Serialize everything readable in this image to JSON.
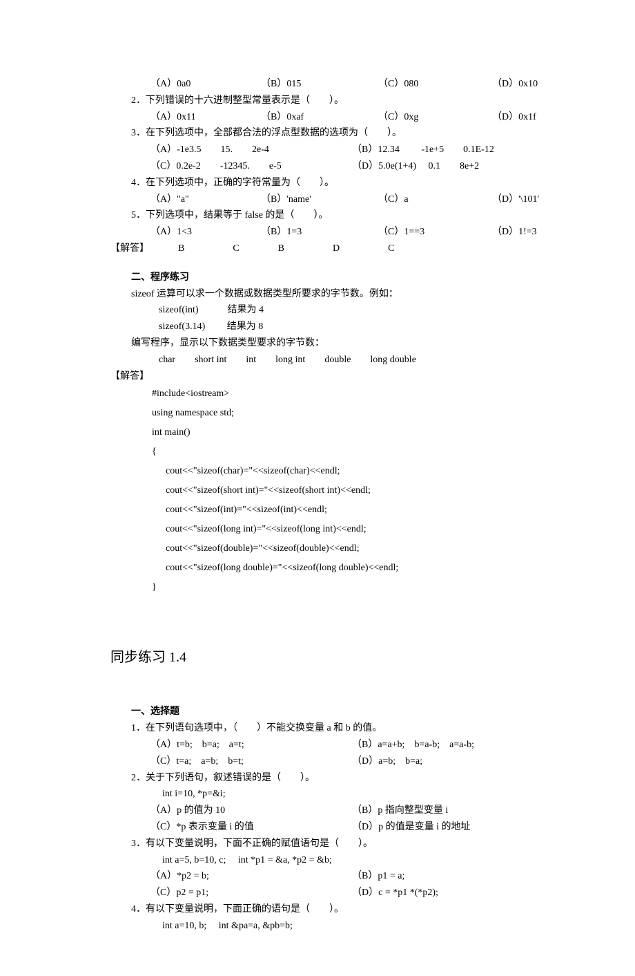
{
  "top": {
    "optsA": {
      "a": "（A）0a0",
      "b": "（B）015",
      "c": "（C）080",
      "d": "（D）0x10"
    },
    "q2": "2．下列错误的十六进制整型常量表示是（　　）。",
    "opts2": {
      "a": "（A）0x11",
      "b": "（B）0xaf",
      "c": "（C）0xg",
      "d": "（D）0x1f"
    },
    "q3": "3．在下列选项中，全部都合法的浮点型数据的选项为（　　）。",
    "opts3a": {
      "a": "（A）-1e3.5　　15.　　2e-4",
      "c": "（B）12.34　　 -1e+5　　0.1E-12"
    },
    "opts3b": {
      "a": "（C）0.2e-2　　-12345.　　e-5",
      "c": "（D）5.0e(1+4)　 0.1　　8e+2"
    },
    "q4": "4．在下列选项中，正确的字符常量为（　　）。",
    "opts4": {
      "a": "（A）\"a\"",
      "b": "（B）'name'",
      "c": "（C）a",
      "d": "（D）'\\101'"
    },
    "q5": "5．下列选项中，结果等于 false 的是（　　）。",
    "opts5": {
      "a": "（A）1<3",
      "b": "（B）1=3",
      "c": "（C）1==3",
      "d": "（D）1!=3"
    },
    "answerLabel": "【解答】",
    "answers": "　　　B　　　　　C　　　　B　　　　　D　　　　　C"
  },
  "sec2": {
    "title": "二、程序练习",
    "p1": "sizeof 运算可以求一个数据或数据类型所要求的字节数。例如：",
    "p2": "sizeof(int)　　　结果为 4",
    "p3": "sizeof(3.14)　　 结果为 8",
    "p4": "编写程序，显示以下数据类型要求的字节数：",
    "p5": "char　　short int　　int　　long int　　double　　long double",
    "ansLabel": "【解答】",
    "code": [
      "#include<iostream>",
      "using namespace std;",
      "int main()",
      "{",
      "  cout<<\"sizeof(char)=\"<<sizeof(char)<<endl;",
      "  cout<<\"sizeof(short int)=\"<<sizeof(short int)<<endl;",
      "  cout<<\"sizeof(int)=\"<<sizeof(int)<<endl;",
      "  cout<<\"sizeof(long int)=\"<<sizeof(long int)<<endl;",
      "  cout<<\"sizeof(double)=\"<<sizeof(double)<<endl;",
      "  cout<<\"sizeof(long double)=\"<<sizeof(long double)<<endl;",
      "}"
    ]
  },
  "bigTitle": "同步练习 1.4",
  "sec3": {
    "title": "一、选择题",
    "q1": "1．在下列语句选项中，（　　）不能交换变量 a 和 b 的值。",
    "o1a": {
      "l": "（A）t=b;　b=a;　a=t;",
      "r": "（B）a=a+b;　b=a-b;　a=a-b;"
    },
    "o1b": {
      "l": "（C）t=a;　a=b;　b=t;",
      "r": "（D）a=b;　b=a;"
    },
    "q2": "2．关于下列语句，叙述错误的是（　　）。",
    "q2code": "int i=10, *p=&i;",
    "o2a": {
      "l": "（A）p 的值为 10",
      "r": "（B）p 指向整型变量 i"
    },
    "o2b": {
      "l": "（C）*p 表示变量 i 的值",
      "r": "（D）p 的值是变量 i 的地址"
    },
    "q3": "3．有以下变量说明，下面不正确的赋值语句是（　　）。",
    "q3code": "int a=5, b=10, c;　 int *p1 = &a, *p2 = &b;",
    "o3a": {
      "l": "（A）*p2 = b;",
      "r": "（B）p1 = a;"
    },
    "o3b": {
      "l": "（C）p2 = p1;",
      "r": "（D）c = *p1 *(*p2);"
    },
    "q4": "4．有以下变量说明，下面正确的语句是（　　）。",
    "q4code": "int a=10, b;　 int &pa=a, &pb=b;"
  }
}
